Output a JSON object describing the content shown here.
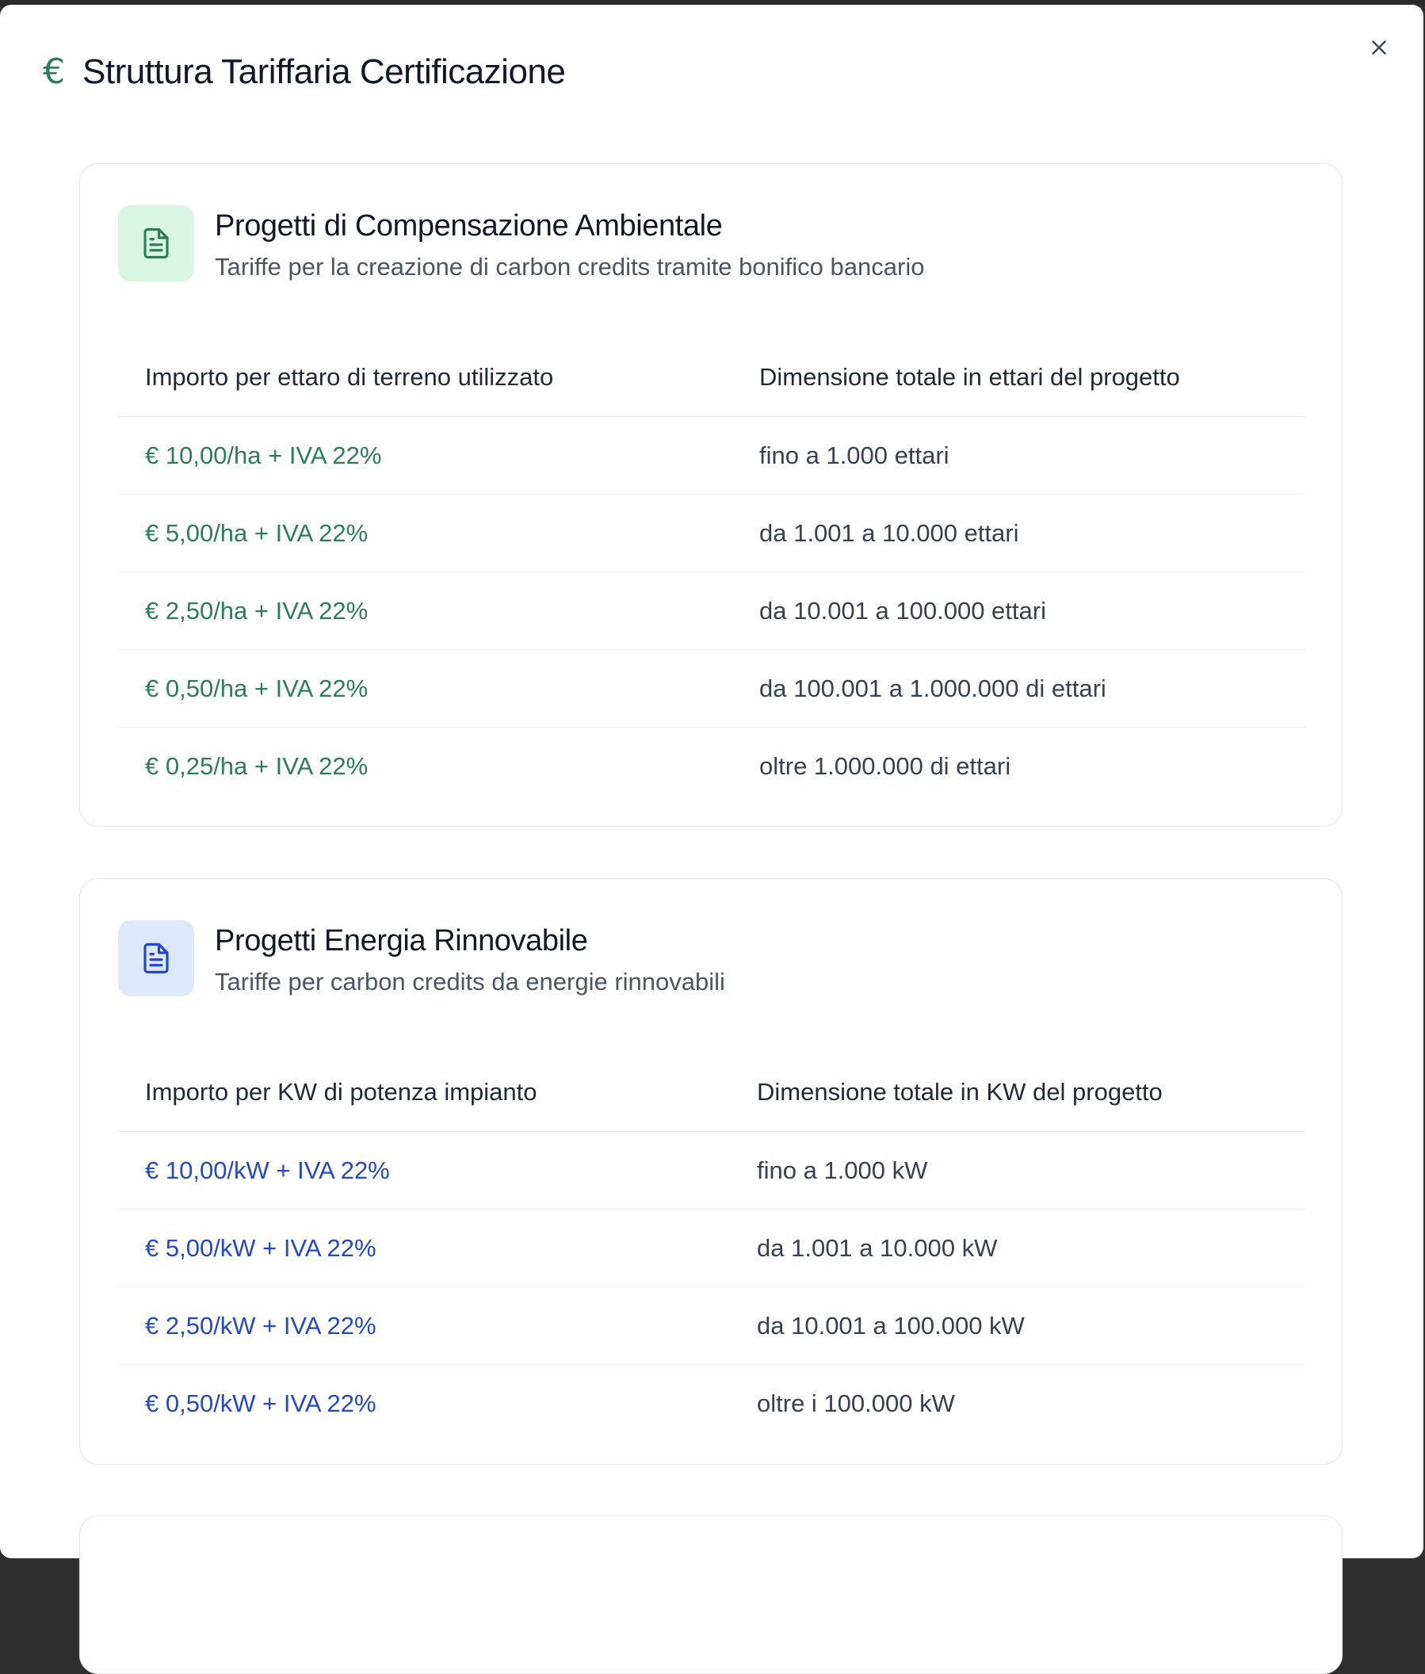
{
  "modal": {
    "title": "Struttura Tariffaria Certificazione",
    "title_icon": "euro-icon",
    "close_icon": "close-icon"
  },
  "sections": [
    {
      "title": "Progetti di Compensazione Ambientale",
      "subtitle": "Tariffe per la creazione di carbon credits tramite bonifico bancario",
      "icon": "document-icon",
      "accent_color": "#2e7d58",
      "icon_bg": "#d9f5e4",
      "columns": [
        "Importo per ettaro di terreno utilizzato",
        "Dimensione totale in ettari del progetto"
      ],
      "rows": [
        {
          "price": "€ 10,00/ha + IVA 22%",
          "range": "fino a 1.000 ettari"
        },
        {
          "price": "€ 5,00/ha + IVA 22%",
          "range": "da 1.001 a 10.000 ettari"
        },
        {
          "price": "€ 2,50/ha + IVA 22%",
          "range": "da 10.001 a 100.000 ettari"
        },
        {
          "price": "€ 0,50/ha + IVA 22%",
          "range": "da 100.001 a 1.000.000 di ettari"
        },
        {
          "price": "€ 0,25/ha + IVA 22%",
          "range": "oltre 1.000.000 di ettari"
        }
      ]
    },
    {
      "title": "Progetti Energia Rinnovabile",
      "subtitle": "Tariffe per carbon credits da energie rinnovabili",
      "icon": "document-icon",
      "accent_color": "#2448c8",
      "icon_bg": "#dde8fb",
      "columns": [
        "Importo per KW di potenza impianto",
        "Dimensione totale in KW del progetto"
      ],
      "rows": [
        {
          "price": "€ 10,00/kW + IVA 22%",
          "range": "fino a 1.000 kW"
        },
        {
          "price": "€ 5,00/kW + IVA 22%",
          "range": "da 1.001 a 10.000 kW"
        },
        {
          "price": "€ 2,50/kW + IVA 22%",
          "range": "da 10.001 a 100.000 kW"
        },
        {
          "price": "€ 0,50/kW + IVA 22%",
          "range": "oltre i 100.000 kW"
        }
      ]
    }
  ]
}
